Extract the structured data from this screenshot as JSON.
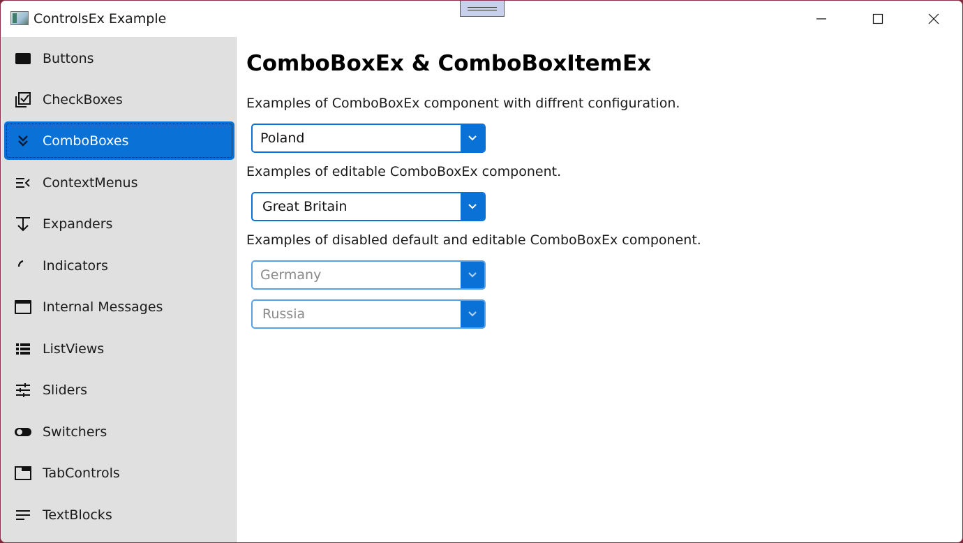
{
  "window": {
    "title": "ControlsEx Example"
  },
  "sidebar": {
    "items": [
      {
        "label": "Buttons",
        "icon": "button-icon"
      },
      {
        "label": "CheckBoxes",
        "icon": "checkbox-icon"
      },
      {
        "label": "ComboBoxes",
        "icon": "double-chevron-down-icon",
        "selected": true
      },
      {
        "label": "ContextMenus",
        "icon": "menu-open-icon"
      },
      {
        "label": "Expanders",
        "icon": "arrow-down-bar-icon"
      },
      {
        "label": "Indicators",
        "icon": "progress-arc-icon"
      },
      {
        "label": "Internal Messages",
        "icon": "message-window-icon"
      },
      {
        "label": "ListViews",
        "icon": "list-icon"
      },
      {
        "label": "Sliders",
        "icon": "sliders-icon"
      },
      {
        "label": "Switchers",
        "icon": "toggle-icon"
      },
      {
        "label": "TabControls",
        "icon": "tab-icon"
      },
      {
        "label": "TextBlocks",
        "icon": "text-lines-icon"
      }
    ]
  },
  "main": {
    "title": "ComboBoxEx & ComboBoxItemEx",
    "desc1": "Examples of ComboBoxEx component with diffrent configuration.",
    "desc2": "Examples of editable ComboBoxEx component.",
    "desc3": "Examples of disabled default and editable ComboBoxEx component.",
    "combo_default": "Poland",
    "combo_editable": "Great Britain",
    "combo_disabled": "Germany",
    "combo_disabled_editable": "Russia"
  },
  "colors": {
    "accent": "#0a72d6",
    "sidebar_bg": "#e0e0e0"
  }
}
